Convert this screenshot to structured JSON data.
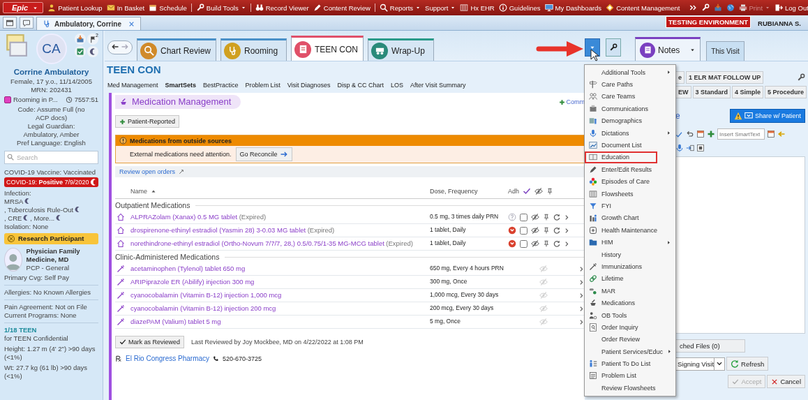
{
  "top_bar": {
    "logo": "Epic",
    "items": [
      {
        "label": "Patient Lookup",
        "dropdown": false,
        "divider": false
      },
      {
        "label": "In Basket",
        "dropdown": false,
        "divider": false
      },
      {
        "label": "Schedule",
        "dropdown": false,
        "divider": true
      },
      {
        "label": "Build Tools",
        "dropdown": true,
        "divider": true
      },
      {
        "label": "Record Viewer",
        "dropdown": false,
        "divider": false
      },
      {
        "label": "Content Review",
        "dropdown": false,
        "divider": true
      },
      {
        "label": "Reports",
        "dropdown": true,
        "divider": false
      },
      {
        "label": "Support",
        "dropdown": true,
        "divider": false
      },
      {
        "label": "Hx EHR",
        "dropdown": false,
        "divider": false
      },
      {
        "label": "Guidelines",
        "dropdown": false,
        "divider": false
      },
      {
        "label": "My Dashboards",
        "dropdown": false,
        "divider": false
      },
      {
        "label": "Content Management",
        "dropdown": false,
        "divider": false
      }
    ],
    "print": {
      "label": "Print",
      "disabled": true
    },
    "logout": "Log Out"
  },
  "workspace_tabs": [
    {
      "label": "Ambulatory, Corrine",
      "selected": true
    }
  ],
  "environment": "TESTING ENVIRONMENT",
  "user": "RUBIANNA S.",
  "patient": {
    "initials": "CA",
    "flag_count": "2",
    "name": "Corrine Ambulatory",
    "demographics": "Female, 17 y.o., 11/14/2005",
    "mrn": "MRN: 202431",
    "status": "Rooming in P...",
    "timer": "7557:51",
    "code": "Code: Assume Full (no ACP docs)",
    "guardian": "Legal Guardian: Ambulatory, Amber",
    "language": "Pref Language: English",
    "search_placeholder": "Search",
    "covid_vaccine": "COVID-19 Vaccine: Vaccinated",
    "covid_alert": "COVID-19: **Positive** 7/9/2020",
    "infection_label": "Infection:",
    "infections": [
      "MRSA",
      ", Tuberculosis Rule-Out",
      ", CRE",
      ", More..."
    ],
    "isolation": "Isolation: None",
    "research": "Research Participant",
    "provider": {
      "name": "Physician Family Medicine, MD",
      "role": "PCP - General"
    },
    "coverage": "Primary Cvg: Self Pay",
    "allergies": "Allergies: No Known Allergies",
    "pain_agreement": "Pain Agreement: Not on File",
    "programs": "Current Programs: None",
    "teen_tag": "1/18 TEEN",
    "teen_note": "for TEEN Confidential",
    "height": "Height:  1.27 m (4' 2\") >90 days (<1%)",
    "weight": "Wt:  27.7 kg (61 lb) >90 days (<1%)"
  },
  "activity_tabs": [
    {
      "label": "Chart Review",
      "selected": false,
      "color": "#4a90c8"
    },
    {
      "label": "Rooming",
      "selected": false,
      "color": "#4a90c8"
    },
    {
      "label": "TEEN CON",
      "selected": true,
      "color": "#e0506a"
    },
    {
      "label": "Wrap-Up",
      "selected": false,
      "color": "#2a9a8a"
    }
  ],
  "notes_tabs": [
    {
      "label": "Notes",
      "selected": true
    },
    {
      "label": "This Visit",
      "selected": false
    }
  ],
  "activity_title": "TEEN CON",
  "nav_links": [
    {
      "label": "Med Management",
      "selected": false
    },
    {
      "label": "SmartSets",
      "selected": true
    },
    {
      "label": "BestPractice",
      "selected": false
    },
    {
      "label": "Problem List",
      "selected": false
    },
    {
      "label": "Visit Diagnoses",
      "selected": false
    },
    {
      "label": "Disp & CC Chart",
      "selected": false
    },
    {
      "label": "LOS",
      "selected": false
    },
    {
      "label": "After Visit Summary",
      "selected": false
    }
  ],
  "med_management": {
    "title": "Medication Management",
    "comment_link": "Comm",
    "patient_reported": "Patient-Reported",
    "outside": {
      "title": "Medications from outside sources",
      "message": "External medications need attention.",
      "button": "Go Reconcile"
    },
    "review_link": "Review open orders",
    "columns": [
      "Name",
      "Dose, Frequency",
      "Adh"
    ],
    "groups": [
      {
        "title": "Outpatient Medications",
        "kind": "outpatient",
        "rows": [
          {
            "name": "ALPRAZolam (Xanax) 0.5 MG tablet",
            "status": "(Expired)",
            "dose": "0.5 mg, 3 times daily PRN",
            "adherence_alert": false,
            "checked": false
          },
          {
            "name": "drospirenone-ethinyl estradiol (Yasmin 28) 3-0.03 MG tablet",
            "status": "(Expired)",
            "dose": "1 tablet, Daily",
            "adherence_alert": true,
            "checked": false
          },
          {
            "name": "norethindrone-ethinyl estradiol (Ortho-Novum 7/7/7, 28,) 0.5/0.75/1-35 MG-MCG tablet",
            "status": "(Expired)",
            "dose": "1 tablet, Daily",
            "adherence_alert": true,
            "checked": false
          }
        ]
      },
      {
        "title": "Clinic-Administered Medications",
        "kind": "clinic",
        "rows": [
          {
            "name": "acetaminophen (Tylenol) tablet 650 mg",
            "dose": "650 mg, Every 4 hours PRN"
          },
          {
            "name": "ARIPiprazole ER (Abilify) injection 300 mg",
            "dose": "300 mg, Once"
          },
          {
            "name": "cyanocobalamin (Vitamin B-12) injection 1,000 mcg",
            "dose": "1,000 mcg, Every 30 days"
          },
          {
            "name": "cyanocobalamin (Vitamin B-12) injection 200 mcg",
            "dose": "200 mcg, Every 30 days"
          },
          {
            "name": "diazePAM (Valium) tablet 5 mg",
            "dose": "5 mg, Once"
          }
        ]
      }
    ],
    "review_button": "Mark as Reviewed",
    "last_reviewed": "Last Reviewed by Joy Mockbee, MD on 4/22/2022 at 1:08 PM",
    "pharmacy": {
      "name": "El Rio Congress Pharmacy",
      "phone": "520-670-3725"
    }
  },
  "notes_panel": {
    "template_rows": [
      [
        "e",
        "1 ELR MAT FOLLOW UP"
      ],
      [
        "EW",
        "3 Standard",
        "4 Simple",
        "5 Procedure"
      ]
    ],
    "link_partial": "e",
    "share_button": "Share w/ Patient",
    "smarttext_placeholder": "Insert SmartText",
    "files_button": "ched Files (0)",
    "visit_select": "Signing Visit",
    "refresh": "Refresh",
    "accept": {
      "label": "Accept",
      "disabled": true
    },
    "cancel": "Cancel"
  },
  "menu": {
    "items": [
      {
        "label": "Additional Tools",
        "submenu": true,
        "highlighted": false
      },
      {
        "label": "Care Paths",
        "submenu": false,
        "highlighted": false
      },
      {
        "label": "Care Teams",
        "submenu": false,
        "highlighted": false
      },
      {
        "label": "Communications",
        "submenu": false,
        "highlighted": false
      },
      {
        "label": "Demographics",
        "submenu": false,
        "highlighted": false
      },
      {
        "label": "Dictations",
        "submenu": true,
        "highlighted": false
      },
      {
        "label": "Document List",
        "submenu": false,
        "highlighted": false
      },
      {
        "label": "Education",
        "submenu": false,
        "highlighted": true
      },
      {
        "label": "Enter/Edit Results",
        "submenu": false,
        "highlighted": false
      },
      {
        "label": "Episodes of Care",
        "submenu": false,
        "highlighted": false
      },
      {
        "label": "Flowsheets",
        "submenu": false,
        "highlighted": false
      },
      {
        "label": "FYI",
        "submenu": false,
        "highlighted": false
      },
      {
        "label": "Growth Chart",
        "submenu": false,
        "highlighted": false
      },
      {
        "label": "Health Maintenance",
        "submenu": false,
        "highlighted": false
      },
      {
        "label": "HIM",
        "submenu": true,
        "highlighted": false
      },
      {
        "label": "History",
        "submenu": false,
        "highlighted": false
      },
      {
        "label": "Immunizations",
        "submenu": false,
        "highlighted": false
      },
      {
        "label": "Lifetime",
        "submenu": false,
        "highlighted": false
      },
      {
        "label": "MAR",
        "submenu": false,
        "highlighted": false
      },
      {
        "label": "Medications",
        "submenu": false,
        "highlighted": false
      },
      {
        "label": "OB Tools",
        "submenu": false,
        "highlighted": false
      },
      {
        "label": "Order Inquiry",
        "submenu": false,
        "highlighted": false
      },
      {
        "label": "Order Review",
        "submenu": false,
        "highlighted": false
      },
      {
        "label": "Patient Services/Educ",
        "submenu": true,
        "highlighted": false
      },
      {
        "label": "Patient To Do List",
        "submenu": false,
        "highlighted": false
      },
      {
        "label": "Problem List",
        "submenu": false,
        "highlighted": false
      },
      {
        "label": "Review Flowsheets",
        "submenu": false,
        "highlighted": false
      }
    ]
  }
}
